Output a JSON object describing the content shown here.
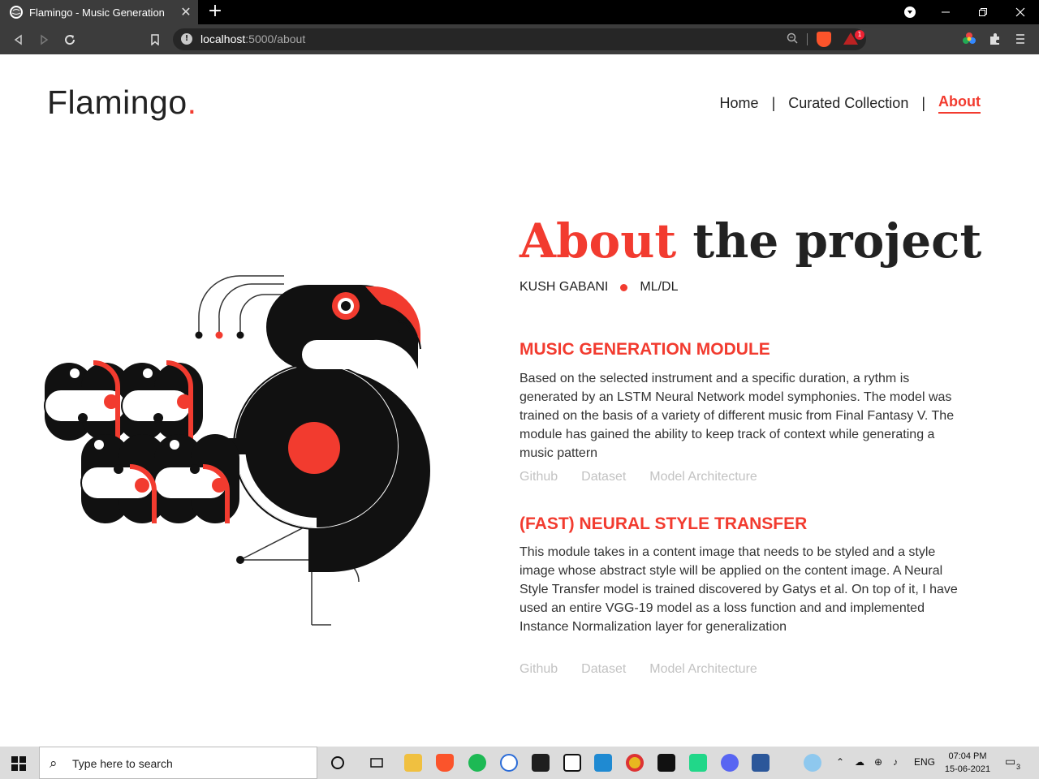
{
  "browser": {
    "tab_title": "Flamingo - Music Generation",
    "tab_close": "✕",
    "new_tab": "+",
    "url_host": "localhost",
    "url_path": ":5000/about",
    "bat_badge": "1"
  },
  "site": {
    "logo_text": "Flamingo",
    "logo_dot": ".",
    "accent_color": "#f23b2f",
    "nav": {
      "home": "Home",
      "separator": "|",
      "collection": "Curated Collection",
      "about": "About"
    }
  },
  "hero": {
    "title_accent": "About",
    "title_rest": "the project",
    "author": "KUSH GABANI",
    "field": "ML/DL"
  },
  "sections": [
    {
      "title": "MUSIC GENERATION MODULE",
      "body": "Based on the selected instrument and a specific duration, a rythm is generated by an LSTM Neural Network model symphonies. The model was trained on the basis of a variety of different music from Final Fantasy V. The module has gained the ability to keep track of context while generating a music pattern",
      "links": [
        "Github",
        "Dataset",
        "Model Architecture"
      ]
    },
    {
      "title": "(FAST) NEURAL STYLE TRANSFER",
      "body": "This module takes in a content image that needs to be styled and a style image whose abstract style will be applied on the content image. A Neural Style Transfer model is trained discovered by Gatys et al. On top of it, I have used an entire VGG-19 model as a loss function and and implemented Instance Normalization layer for generalization",
      "links": [
        "Github",
        "Dataset",
        "Model Architecture"
      ]
    }
  ],
  "taskbar": {
    "search_placeholder": "Type here to search",
    "language": "ENG",
    "time": "07:04 PM",
    "date": "15-06-2021",
    "notification_count": "3"
  }
}
